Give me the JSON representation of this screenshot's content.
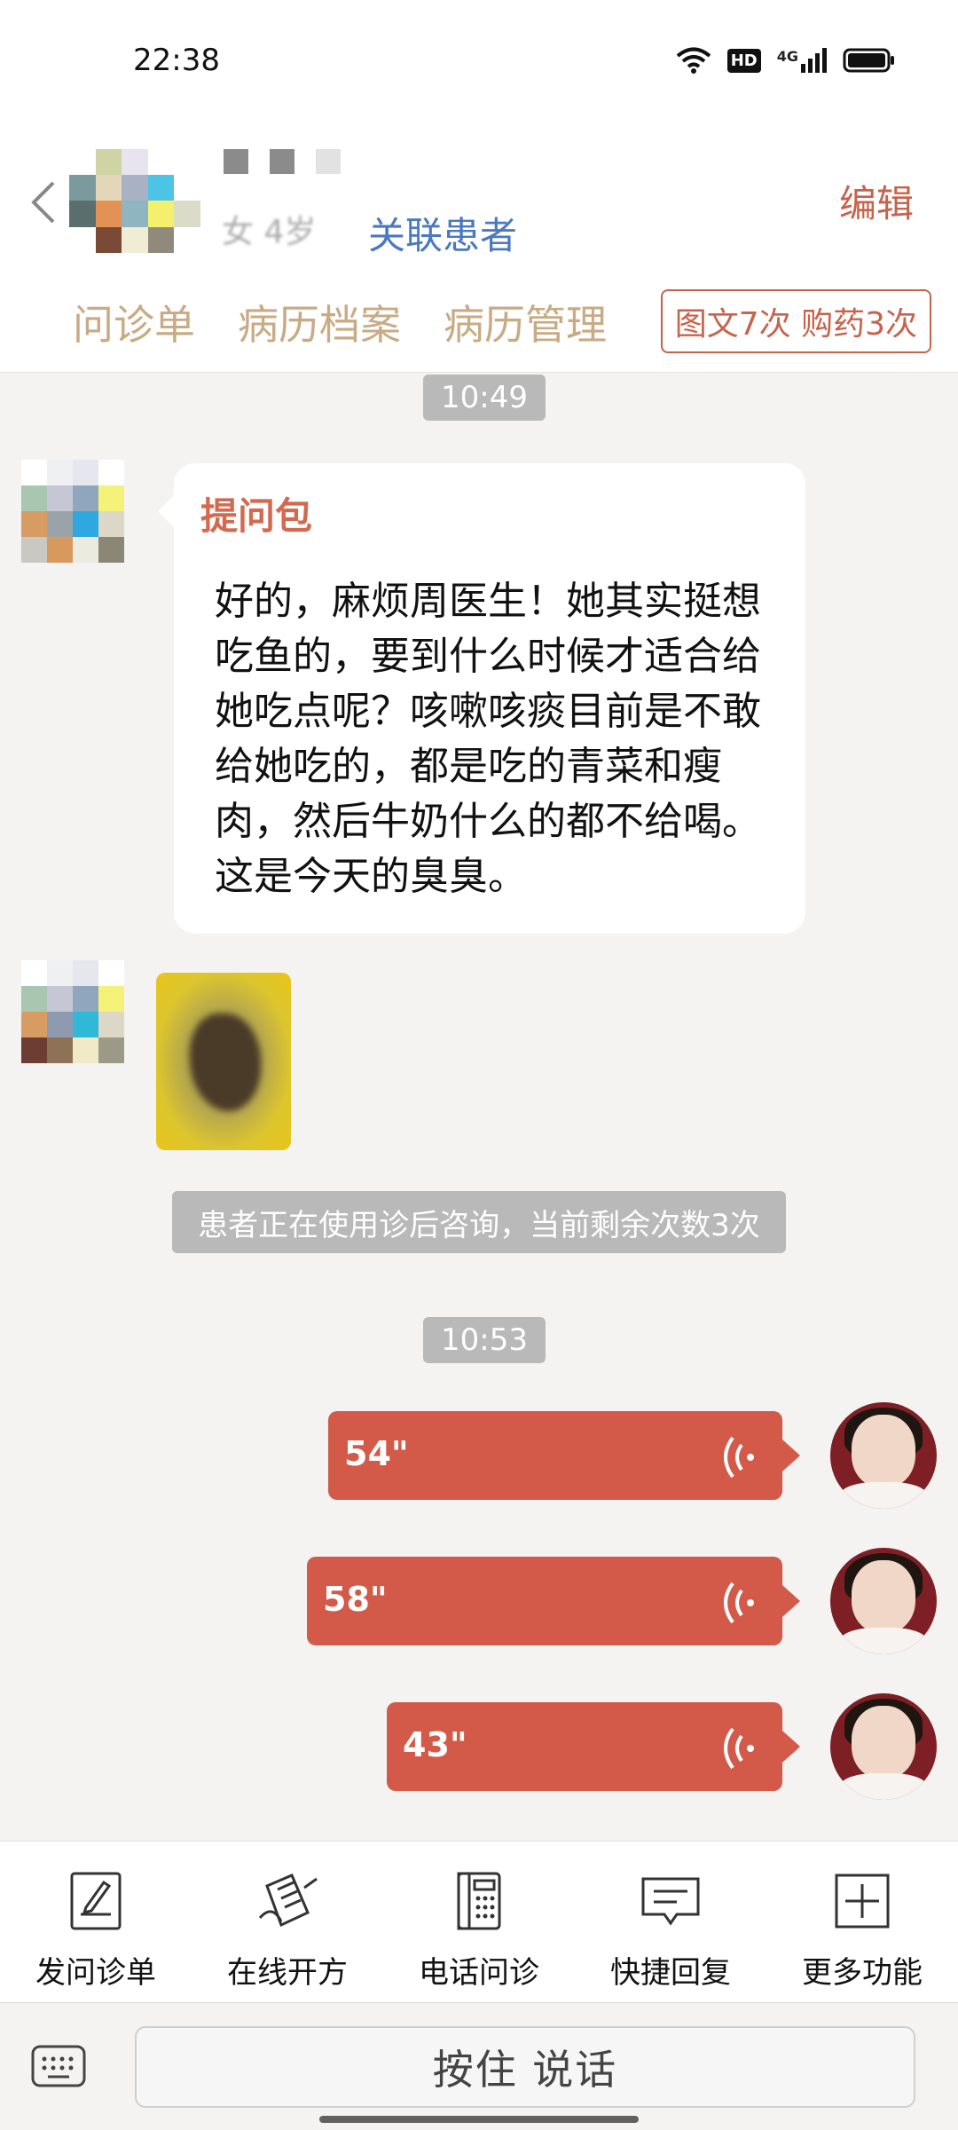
{
  "status_bar": {
    "time": "22:38",
    "hd_label": "HD",
    "network_label": "4G"
  },
  "header": {
    "patient_meta": "女 4岁",
    "link_label": "关联患者",
    "edit_label": "编辑",
    "tabs": [
      {
        "label": "问诊单"
      },
      {
        "label": "病历档案"
      },
      {
        "label": "病历管理"
      }
    ],
    "counter_badge": "图文7次 购药3次"
  },
  "chat": {
    "time_1": "10:49",
    "question_title": "提问包",
    "question_text": "好的，麻烦周医生！她其实挺想吃鱼的，要到什么时候才适合给她吃点呢？咳嗽咳痰目前是不敢给她吃的，都是吃的青菜和瘦肉，然后牛奶什么的都不给喝。这是今天的臭臭。",
    "system_note": "患者正在使用诊后咨询，当前剩余次数3次",
    "time_2": "10:53",
    "voice_messages": [
      {
        "duration": "54\""
      },
      {
        "duration": "58\""
      },
      {
        "duration": "43\""
      }
    ]
  },
  "toolbar": {
    "items": [
      {
        "label": "发问诊单",
        "icon": "form-icon"
      },
      {
        "label": "在线开方",
        "icon": "prescription-icon"
      },
      {
        "label": "电话问诊",
        "icon": "phone-icon"
      },
      {
        "label": "快捷回复",
        "icon": "quick-reply-icon"
      },
      {
        "label": "更多功能",
        "icon": "plus-icon"
      }
    ]
  },
  "input": {
    "talk_label": "按住 说话"
  },
  "colors": {
    "accent": "#d35a48",
    "tab_text": "#c8ab85",
    "link": "#4a78c2",
    "background": "#f4f3f1"
  }
}
